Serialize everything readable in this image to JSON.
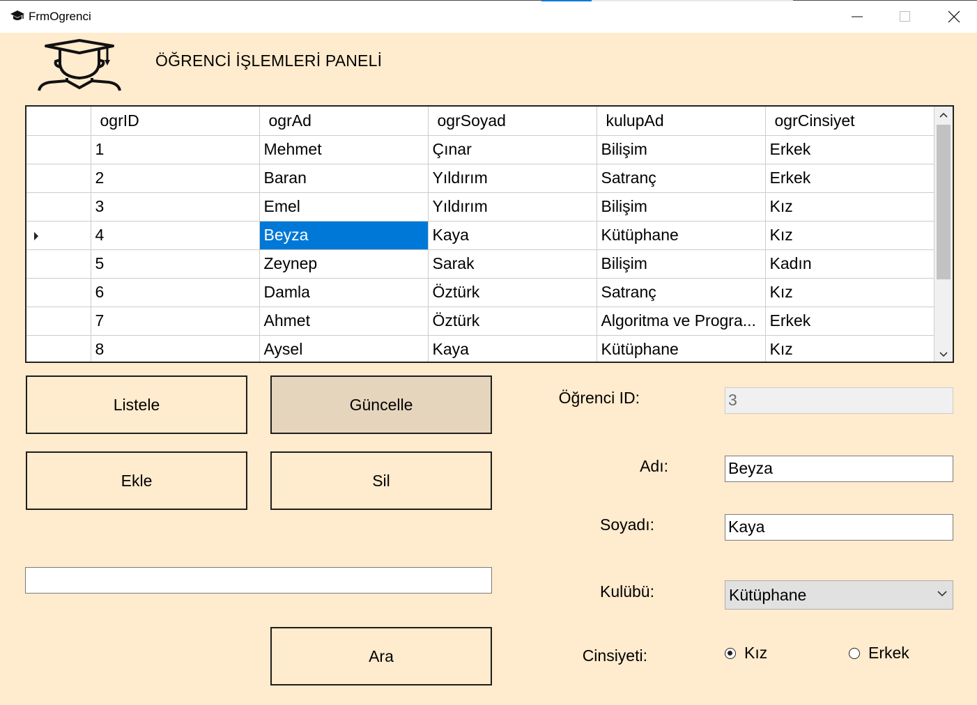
{
  "window": {
    "title": "FrmOgrenci",
    "icon": "graduation-cap-icon",
    "controls": [
      "minimize-icon",
      "maximize-icon",
      "close-icon"
    ]
  },
  "header": {
    "logo_icon": "student-graduate-icon",
    "title": "ÖĞRENCİ İŞLEMLERİ PANELİ"
  },
  "grid": {
    "columns": [
      "ogrID",
      "ogrAd",
      "ogrSoyad",
      "kulupAd",
      "ogrCinsiyet"
    ],
    "rows": [
      {
        "id": "1",
        "ad": "Mehmet",
        "soyad": "Çınar",
        "kulup": "Bilişim",
        "cinsiyet": "Erkek"
      },
      {
        "id": "2",
        "ad": "Baran",
        "soyad": "Yıldırım",
        "kulup": "Satranç",
        "cinsiyet": "Erkek"
      },
      {
        "id": "3",
        "ad": "Emel",
        "soyad": "Yıldırım",
        "kulup": "Bilişim",
        "cinsiyet": "Kız"
      },
      {
        "id": "4",
        "ad": "Beyza",
        "soyad": "Kaya",
        "kulup": "Kütüphane",
        "cinsiyet": "Kız"
      },
      {
        "id": "5",
        "ad": "Zeynep",
        "soyad": "Sarak",
        "kulup": "Bilişim",
        "cinsiyet": "Kadın"
      },
      {
        "id": "6",
        "ad": "Damla",
        "soyad": "Öztürk",
        "kulup": "Satranç",
        "cinsiyet": "Kız"
      },
      {
        "id": "7",
        "ad": "Ahmet",
        "soyad": "Öztürk",
        "kulup": "Algoritma ve Progra...",
        "cinsiyet": "Erkek"
      },
      {
        "id": "8",
        "ad": "Aysel",
        "soyad": "Kaya",
        "kulup": "Kütüphane",
        "cinsiyet": "Kız"
      }
    ],
    "current_row": 4,
    "selected_cell": "ogrAd"
  },
  "buttons": {
    "listele": "Listele",
    "guncelle": "Güncelle",
    "ekle": "Ekle",
    "sil": "Sil",
    "ara": "Ara"
  },
  "search": {
    "value": ""
  },
  "form": {
    "id_label": "Öğrenci ID:",
    "id_value": "3",
    "ad_label": "Adı:",
    "ad_value": "Beyza",
    "soyad_label": "Soyadı:",
    "soyad_value": "Kaya",
    "kulup_label": "Kulübü:",
    "kulup_value": "Kütüphane",
    "cinsiyet_label": "Cinsiyeti:",
    "radio_kiz": "Kız",
    "radio_erkek": "Erkek",
    "selected_gender": "Kız"
  },
  "colors": {
    "background": "#ffebcd",
    "selection": "#0078d7",
    "button_active": "#e6d5bd"
  }
}
